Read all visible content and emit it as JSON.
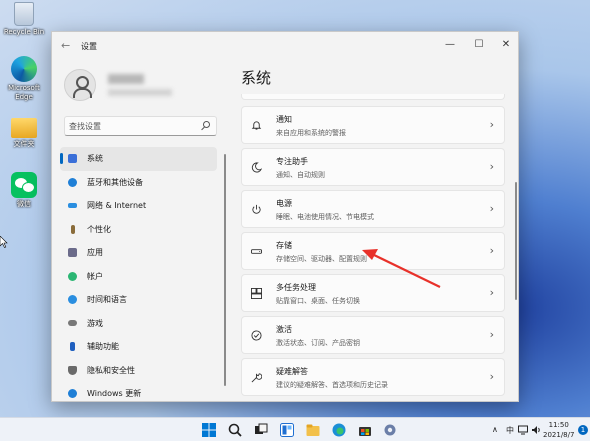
{
  "desktop": {
    "icons": [
      {
        "label": "Recycle Bin",
        "icon": "recycle-bin-icon"
      },
      {
        "label": "Microsoft Edge",
        "icon": "edge-icon"
      },
      {
        "label": "文件夹",
        "icon": "folder-icon"
      },
      {
        "label": "微信",
        "icon": "wechat-icon"
      }
    ]
  },
  "window": {
    "title": "设置",
    "minimize": "—",
    "maximize": "☐",
    "close": "✕",
    "back": "←"
  },
  "search": {
    "placeholder": "查找设置"
  },
  "sidebar": {
    "items": [
      {
        "label": "系统",
        "color": "#3a6fd8",
        "active": true
      },
      {
        "label": "蓝牙和其他设备",
        "color": "#1f7fd6"
      },
      {
        "label": "网络 & Internet",
        "color": "#2a8ee0"
      },
      {
        "label": "个性化",
        "color": "#8a6c3a"
      },
      {
        "label": "应用",
        "color": "#6b6b8a"
      },
      {
        "label": "帐户",
        "color": "#2bb673"
      },
      {
        "label": "时间和语言",
        "color": "#2a8ee0"
      },
      {
        "label": "游戏",
        "color": "#777777"
      },
      {
        "label": "辅助功能",
        "color": "#1f5fbf"
      },
      {
        "label": "隐私和安全性",
        "color": "#6a6a6a"
      },
      {
        "label": "Windows 更新",
        "color": "#1f7fd6"
      }
    ]
  },
  "main": {
    "title": "系统",
    "cards": [
      {
        "title": "通知",
        "subtitle": "来自应用和系统的警报",
        "icon": "bell-icon"
      },
      {
        "title": "专注助手",
        "subtitle": "通知、自动规则",
        "icon": "moon-icon"
      },
      {
        "title": "电源",
        "subtitle": "睡眠、电池使用情况、节电模式",
        "icon": "power-icon"
      },
      {
        "title": "存储",
        "subtitle": "存储空间、驱动器、配置规则",
        "icon": "storage-icon"
      },
      {
        "title": "多任务处理",
        "subtitle": "贴靠窗口、桌面、任务切换",
        "icon": "multitask-icon"
      },
      {
        "title": "激活",
        "subtitle": "激活状态、订阅、产品密钥",
        "icon": "activation-icon"
      },
      {
        "title": "疑难解答",
        "subtitle": "建议的疑难解答、首选项和历史记录",
        "icon": "wrench-icon"
      }
    ]
  },
  "taskbar": {
    "ime": "中",
    "time": "11:50",
    "date": "2021/8/7",
    "notifications": "1",
    "tray_chevron": "∧"
  },
  "colors": {
    "accent": "#0067c0",
    "annotation_arrow": "#e8312a"
  }
}
